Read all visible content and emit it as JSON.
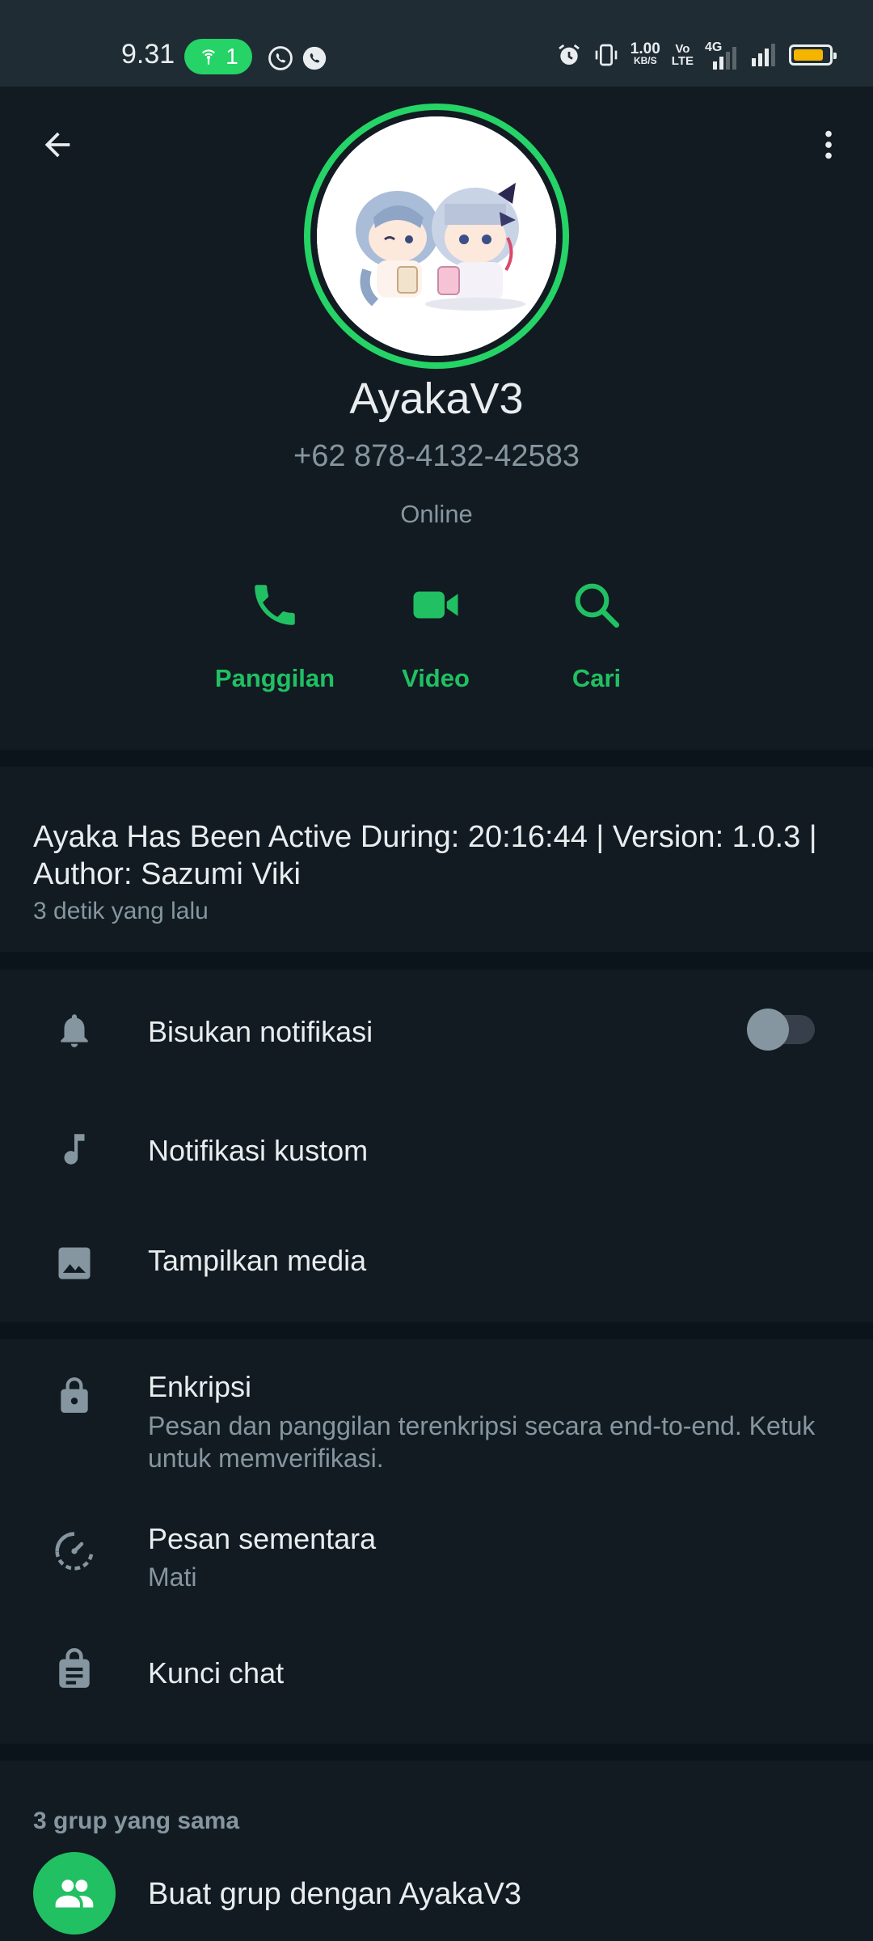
{
  "status_bar": {
    "time": "9.31",
    "hotspot_count": "1",
    "net_speed_value": "1.00",
    "net_speed_unit": "KB/S",
    "volte_top": "Vo",
    "volte_bottom": "LTE",
    "network_type": "4G",
    "battery_level": 0.85,
    "battery_color": "#f5b400"
  },
  "profile": {
    "name": "AyakaV3",
    "phone": "+62 878-4132-42583",
    "presence": "Online",
    "ring_color": "#25d366"
  },
  "actions": [
    {
      "label": "Panggilan",
      "icon": "phone-icon"
    },
    {
      "label": "Video",
      "icon": "video-icon"
    },
    {
      "label": "Cari",
      "icon": "search-icon"
    }
  ],
  "about": {
    "text": "Ayaka Has Been Active During: 20:16:44 | Version: 1.0.3 | Author: Sazumi Viki",
    "time": "3 detik yang lalu"
  },
  "settings": {
    "mute": {
      "label": "Bisukan notifikasi",
      "on": false
    },
    "custom_notif": {
      "label": "Notifikasi kustom"
    },
    "media": {
      "label": "Tampilkan media"
    }
  },
  "privacy": {
    "encryption": {
      "label": "Enkripsi",
      "sub": "Pesan dan panggilan terenkripsi secara end-to-end. Ketuk untuk memverifikasi."
    },
    "disappearing": {
      "label": "Pesan sementara",
      "sub": "Mati"
    },
    "chat_lock": {
      "label": "Kunci chat"
    }
  },
  "groups": {
    "header": "3 grup yang sama",
    "create_label": "Buat grup dengan AyakaV3"
  },
  "colors": {
    "accent": "#21c063",
    "background": "#0b141a",
    "panel": "#111b21",
    "secondary_text": "#8696a0"
  }
}
